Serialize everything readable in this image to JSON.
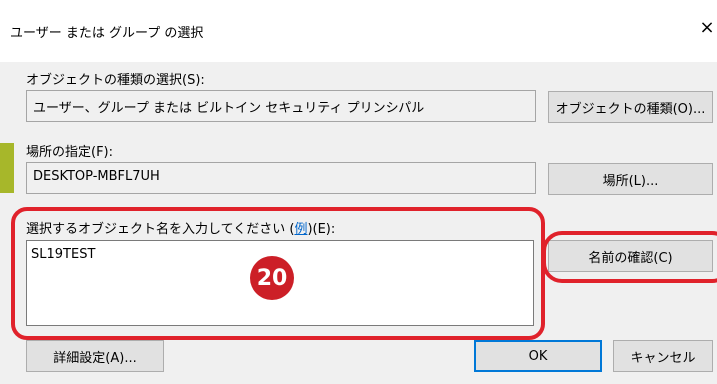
{
  "window": {
    "title": "ユーザー または グループ の選択",
    "close_glyph": "×"
  },
  "object_type": {
    "label": "オブジェクトの種類の選択(S):",
    "value": "ユーザー、グループ または ビルトイン セキュリティ プリンシパル",
    "button": "オブジェクトの種類(O)..."
  },
  "location": {
    "label": "場所の指定(F):",
    "value": "DESKTOP-MBFL7UH",
    "button": "場所(L)..."
  },
  "object_name": {
    "label_prefix": "選択するオブジェクト名を入力してください (",
    "label_link": "例",
    "label_suffix": ")(E):",
    "value": "SL19TEST",
    "check_button": "名前の確認(C)"
  },
  "footer": {
    "advanced_button": "詳細設定(A)...",
    "ok_button": "OK",
    "cancel_button": "キャンセル"
  },
  "annotation": {
    "step_number": "20",
    "highlight_color": "#e0222b"
  }
}
